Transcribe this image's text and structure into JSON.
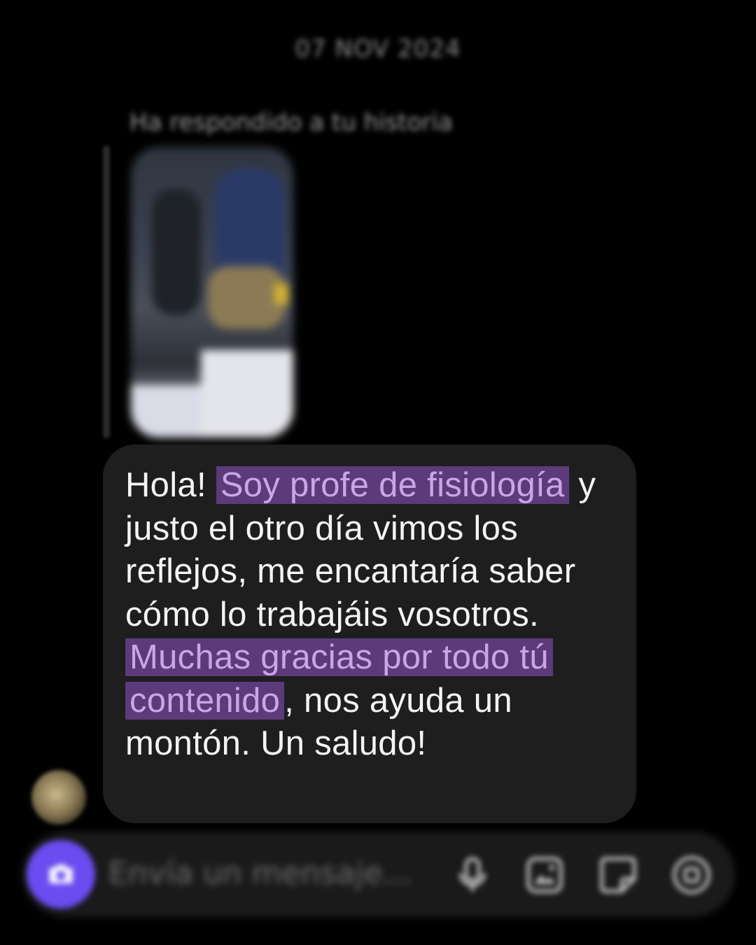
{
  "chat": {
    "date_separator": "07 NOV 2024",
    "story_reply_label": "Ha respondido a tu historia",
    "message": {
      "segments": [
        {
          "text": "Hola! ",
          "highlight": false
        },
        {
          "text": "Soy profe de fisiología",
          "highlight": true
        },
        {
          "text": " y justo el otro día vimos los reflejos, me encantaría saber cómo lo trabajáis vosotros. ",
          "highlight": false
        },
        {
          "text": "Muchas gracias por todo tú contenido",
          "highlight": true
        },
        {
          "text": ", nos ayuda un montón. Un saludo!",
          "highlight": false
        }
      ]
    }
  },
  "composer": {
    "placeholder": "Envía un mensaje...",
    "camera_icon": "camera-icon",
    "mic_icon": "microphone-icon",
    "gallery_icon": "image-gallery-icon",
    "sticker_icon": "sticker-icon",
    "more_icon": "plus-circle-icon"
  },
  "colors": {
    "background": "#000000",
    "bubble": "#1e1e1e",
    "highlight_bg": "#5d3a7a",
    "highlight_text": "#c8a6e8",
    "camera_button": "#6a4cf0"
  }
}
